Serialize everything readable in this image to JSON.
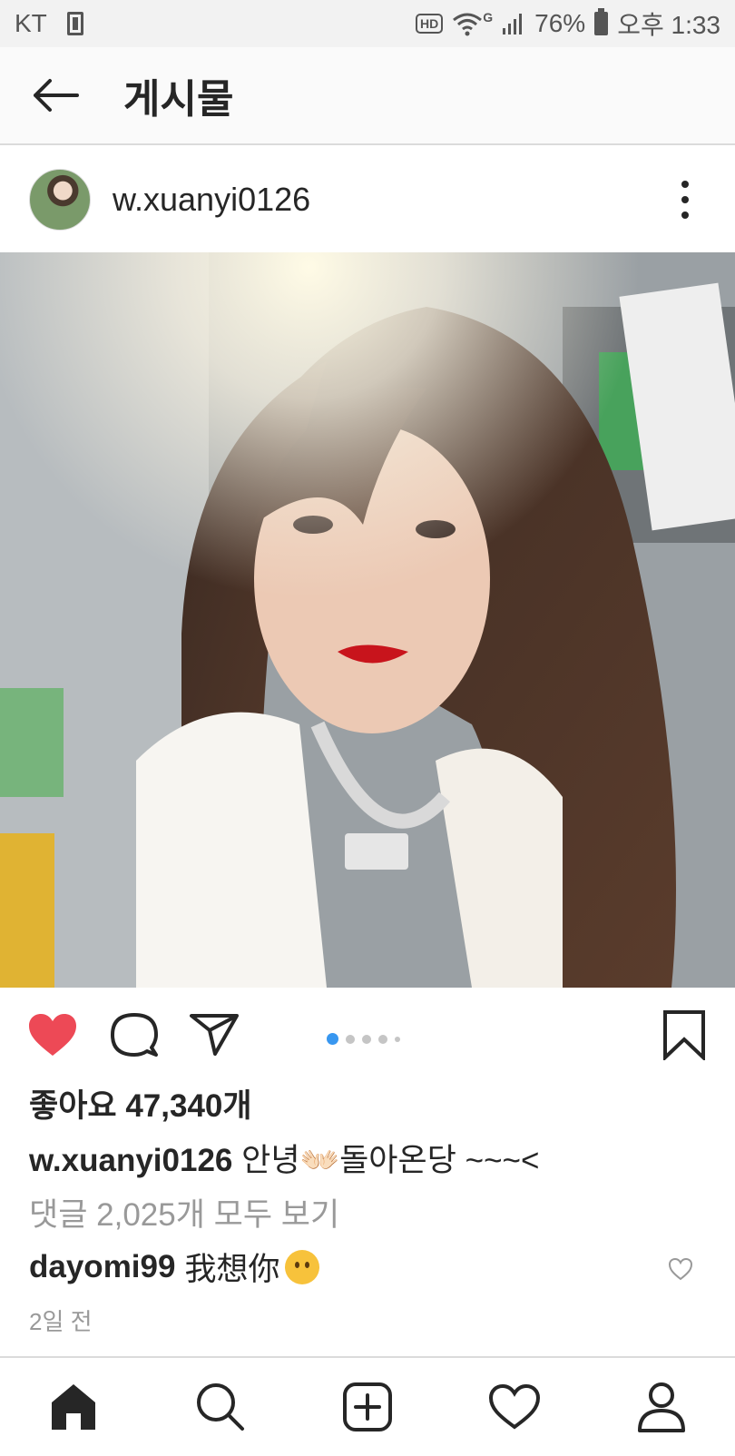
{
  "status_bar": {
    "carrier": "KT",
    "battery": "76%",
    "time": "오후 1:33",
    "hd_badge": "HD",
    "network_badge": "G"
  },
  "header": {
    "title": "게시물"
  },
  "post": {
    "username": "w.xuanyi0126",
    "carousel": {
      "total": 5,
      "active_index": 0
    },
    "likes_text": "좋아요 47,340개",
    "caption": {
      "username": "w.xuanyi0126",
      "text": "안녕👐🏻돌아온당 ~~~<"
    },
    "view_comments": "댓글 2,025개 모두 보기",
    "top_comment": {
      "username": "dayomi99",
      "text": "我想你"
    },
    "time_ago": "2일 전"
  },
  "colors": {
    "like_red": "#ed4956",
    "carousel_active": "#3897f0",
    "text_primary": "#262626",
    "text_secondary": "#999999"
  },
  "icons": {
    "back": "arrow-left-icon",
    "more": "more-vertical-icon",
    "like": "heart-filled-icon",
    "comment": "comment-icon",
    "share": "paper-plane-icon",
    "save": "bookmark-icon",
    "nav": [
      "home-icon",
      "search-icon",
      "add-icon",
      "activity-heart-icon",
      "profile-icon"
    ]
  }
}
